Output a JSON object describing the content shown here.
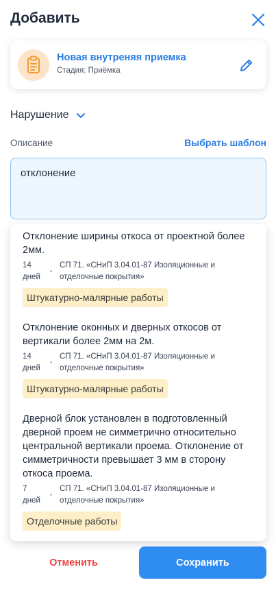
{
  "header": {
    "title": "Добавить",
    "close_icon": "close-icon"
  },
  "card": {
    "icon": "clipboard-icon",
    "title": "Новая внутреняя приемка",
    "stage": "Стадия: Приёмка",
    "edit_icon": "pencil-icon"
  },
  "section": {
    "label": "Нарушение",
    "chevron_icon": "chevron-down-icon"
  },
  "description": {
    "label": "Описание",
    "template_link": "Выбрать шаблон",
    "value": "отклонение"
  },
  "suggestions": [
    {
      "title": "Отклонение ширины откоса от проектной более 2мм.",
      "days": "14 дней",
      "norm": "СП 71. «СНиП 3.04.01-87 Изоляционные и отделочные покрытия»",
      "tag": "Штукатурно-малярные работы"
    },
    {
      "title": "Отклонение оконных и дверных откосов от вертикали более 2мм на 2м.",
      "days": "14 дней",
      "norm": "СП 71. «СНиП 3.04.01-87 Изоляционные и отделочные покрытия»",
      "tag": "Штукатурно-малярные работы"
    },
    {
      "title": "Дверной блок установлен в подготовленный дверной проем не симметрично относительно центральной вертикали проема. Отклонение от симметричности превышает 3 мм в сторону откоса проема.",
      "days": "7 дней",
      "norm": "СП 71. «СНиП 3.04.01-87 Изоляционные и отделочные покрытия»",
      "tag": "Отделочные работы"
    }
  ],
  "footer": {
    "cancel_label": "Отменить",
    "save_label": "Сохранить"
  },
  "colors": {
    "accent": "#2f8cf0",
    "link": "#2a7de1",
    "danger": "#ef4444",
    "tag_bg": "#fdefc7",
    "icon_bg": "#fde4c8"
  }
}
